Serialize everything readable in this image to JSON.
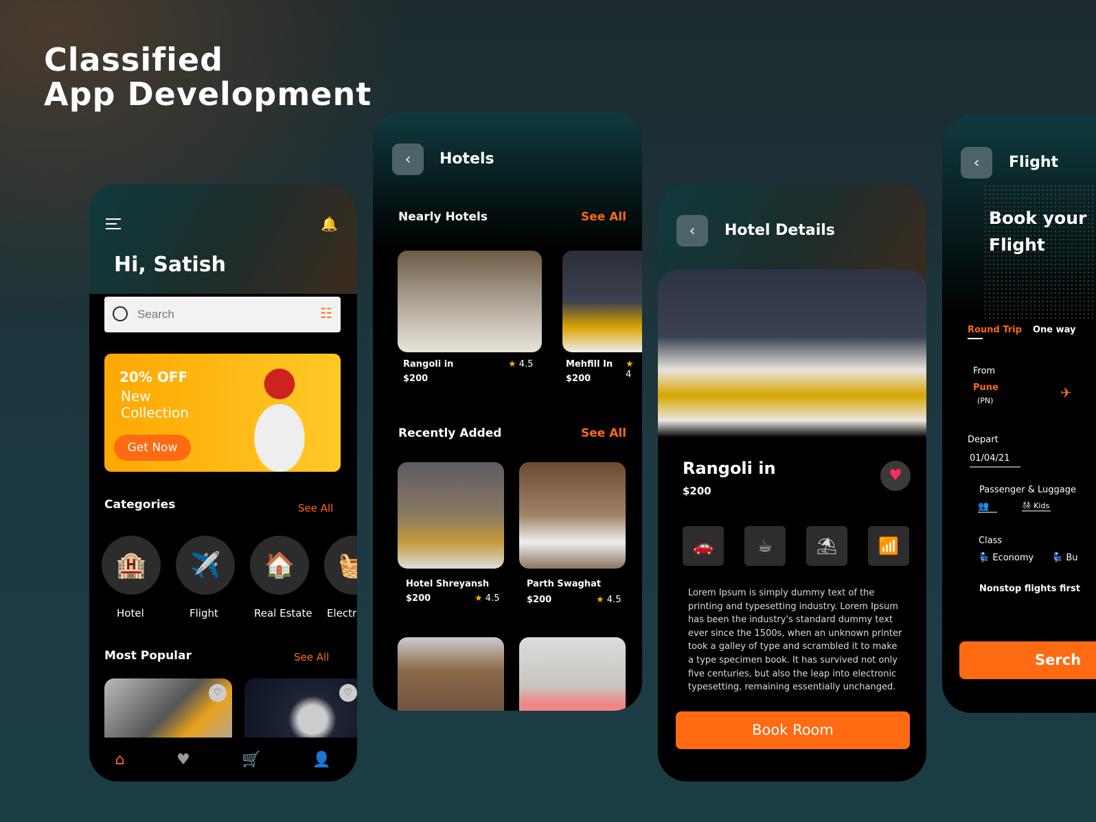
{
  "hero": {
    "line1": "Classified",
    "line2": "App Development"
  },
  "home": {
    "greeting": "Hi, Satish",
    "search_placeholder": "Search",
    "banner": {
      "discount": "20% OFF",
      "line1": "New",
      "line2": "Collection",
      "cta": "Get Now"
    },
    "categories_title": "Categories",
    "see_all": "See All",
    "categories": [
      {
        "label": "Hotel"
      },
      {
        "label": "Flight"
      },
      {
        "label": "Real Estate"
      },
      {
        "label": "Electr"
      }
    ],
    "popular_title": "Most Popular"
  },
  "hotels": {
    "title": "Hotels",
    "nearby_title": "Nearly Hotels",
    "see_all": "See All",
    "recent_title": "Recently Added",
    "nearby": [
      {
        "name": "Rangoli in",
        "price": "$200",
        "rating": "4.5"
      },
      {
        "name": "Mehfill In",
        "price": "$200",
        "rating": "4"
      }
    ],
    "recent": [
      {
        "name": "Hotel Shreyansh",
        "price": "$200",
        "rating": "4.5"
      },
      {
        "name": "Parth Swaghat",
        "price": "$200",
        "rating": "4.5"
      }
    ]
  },
  "details": {
    "title": "Hotel Details",
    "name": "Rangoli in",
    "price": "$200",
    "description": "Lorem Ipsum is simply dummy text of the printing and typesetting industry. Lorem Ipsum has been the industry's standard dummy text ever since the 1500s, when an unknown printer took a galley of type and scrambled it to make a type specimen book. It has survived not only five centuries, but also the leap into electronic typesetting, remaining essentially unchanged.",
    "book": "Book Room",
    "amenities": [
      "parking-icon",
      "coffee-icon",
      "pool-icon",
      "wifi-icon"
    ]
  },
  "flight": {
    "title": "Flight",
    "headline1": "Book your",
    "headline2": "Flight",
    "tab_round": "Round Trip",
    "tab_oneway": "One way",
    "from_label": "From",
    "from_city": "Pune",
    "from_code": "(PN)",
    "depart_label": "Depart",
    "depart_value": "01/04/21",
    "passenger_label": "Passenger & Luggage",
    "kids": "Kids",
    "class_label": "Class",
    "economy": "Economy",
    "business": "Bu",
    "nonstop": "Nonstop flights first",
    "search": "Serch"
  },
  "colors": {
    "accent": "#ff6a13",
    "background": "#1d3a42"
  }
}
